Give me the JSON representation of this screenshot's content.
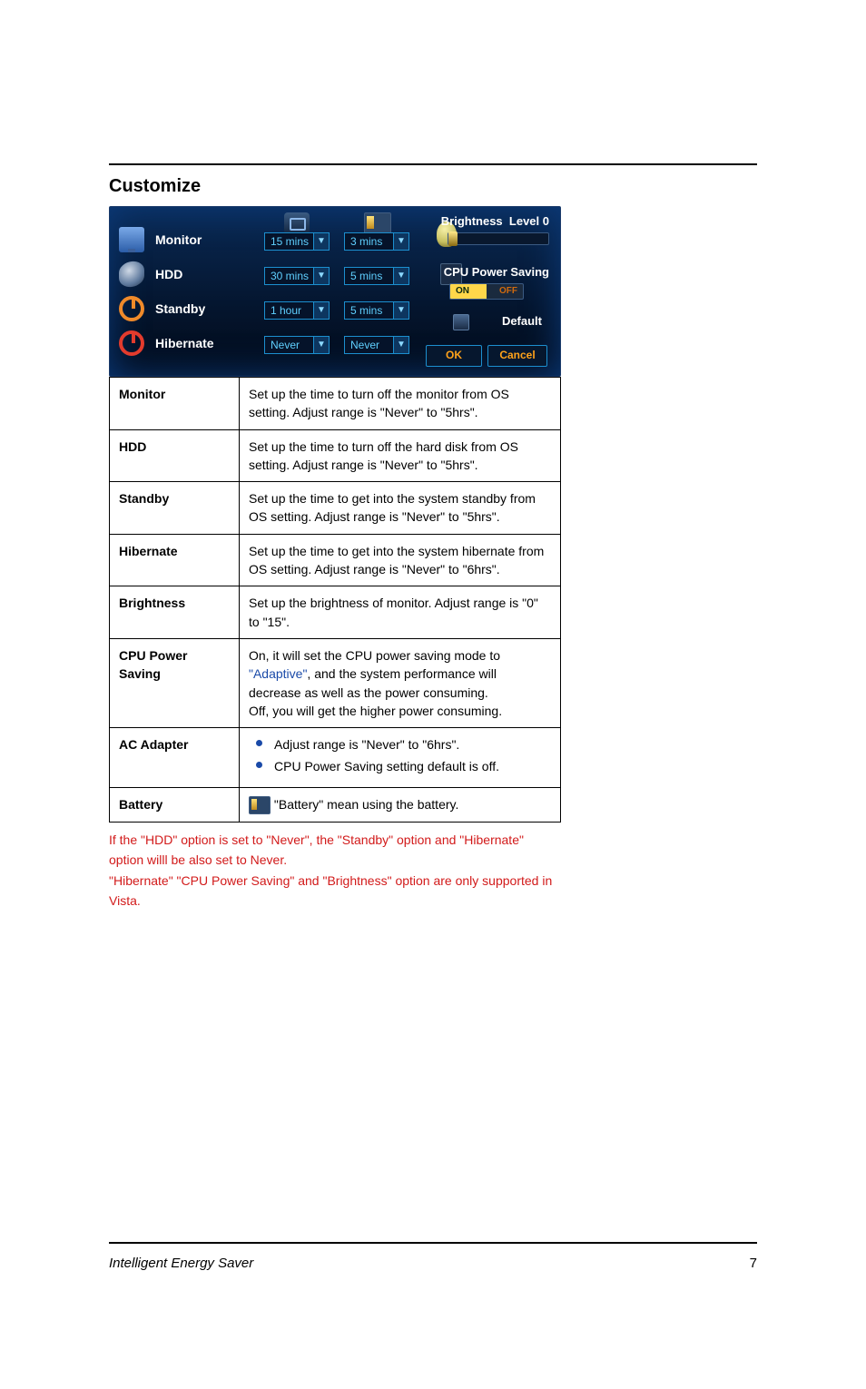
{
  "section_title": "Customize",
  "panel": {
    "rows": [
      {
        "label": "Monitor",
        "ac": "15 mins",
        "bat": "3 mins"
      },
      {
        "label": "HDD",
        "ac": "30 mins",
        "bat": "5 mins"
      },
      {
        "label": "Standby",
        "ac": "1 hour",
        "bat": "5 mins"
      },
      {
        "label": "Hibernate",
        "ac": "Never",
        "bat": "Never"
      }
    ],
    "brightness_label": "Brightness",
    "brightness_level": "Level 0",
    "cpu_label": "CPU Power Saving",
    "on": "ON",
    "off": "OFF",
    "default": "Default",
    "ok": "OK",
    "cancel": "Cancel"
  },
  "table": {
    "monitor": {
      "l": "Monitor",
      "r": "Set up the time to turn off the monitor from OS setting. Adjust range is \"Never\" to \"5hrs\"."
    },
    "hdd": {
      "l": "HDD",
      "r": "Set up the time to turn off the hard disk from OS setting. Adjust range is \"Never\" to \"5hrs\"."
    },
    "standby": {
      "l": "Standby",
      "r": "Set up the time to get into the system standby from OS setting. Adjust range is \"Never\" to \"5hrs\"."
    },
    "hibernate": {
      "l": "Hibernate",
      "r": "Set up the time to get into the system hibernate from OS setting. Adjust range is \"Never\" to \"6hrs\"."
    },
    "brightness": {
      "l": "Brightness",
      "r": "Set up the brightness of monitor. Adjust range is \"0\" to \"15\"."
    },
    "cpu_power_saving": {
      "l": "CPU Power Saving",
      "on_pre": "On, it will set the CPU power saving mode to ",
      "on_val": "\"Adaptive\"",
      "on_post": ", and the system performance will decrease as well as the power consuming.",
      "off": "Off, you will get the higher power consuming."
    },
    "ac_adapter": {
      "l": "AC Adapter",
      "bullet1": "Adjust range is \"Never\" to \"6hrs\".",
      "bullet2": "CPU Power Saving setting default is off."
    },
    "battery": {
      "l": "Battery",
      "r_pre": " \"",
      "r_val": "Battery",
      "r_post": "\" mean using the battery."
    }
  },
  "note": {
    "line1_pre": "If the \"",
    "line1_hdd": "HDD",
    "line1_mid": "\" option is set to \"",
    "line1_never": "Never",
    "line1_mid2": "\", the \"",
    "line1_standby": "Standby",
    "line1_mid3": "\" option and \"",
    "line1_hibernate": "Hibernate",
    "line1_end": "\" option willl be also set to Never.",
    "line2_pre": "\"",
    "line2_hibernate": "Hibernate",
    "line2_mid": "\" \"",
    "line2_cpu": "CPU Power Saving",
    "line2_mid2": "\" and \"",
    "line2_brightness": "Brightness",
    "line2_end": "\" option are only supported in Vista."
  },
  "footer": {
    "title": "Intelligent Energy Saver",
    "page": "7"
  }
}
